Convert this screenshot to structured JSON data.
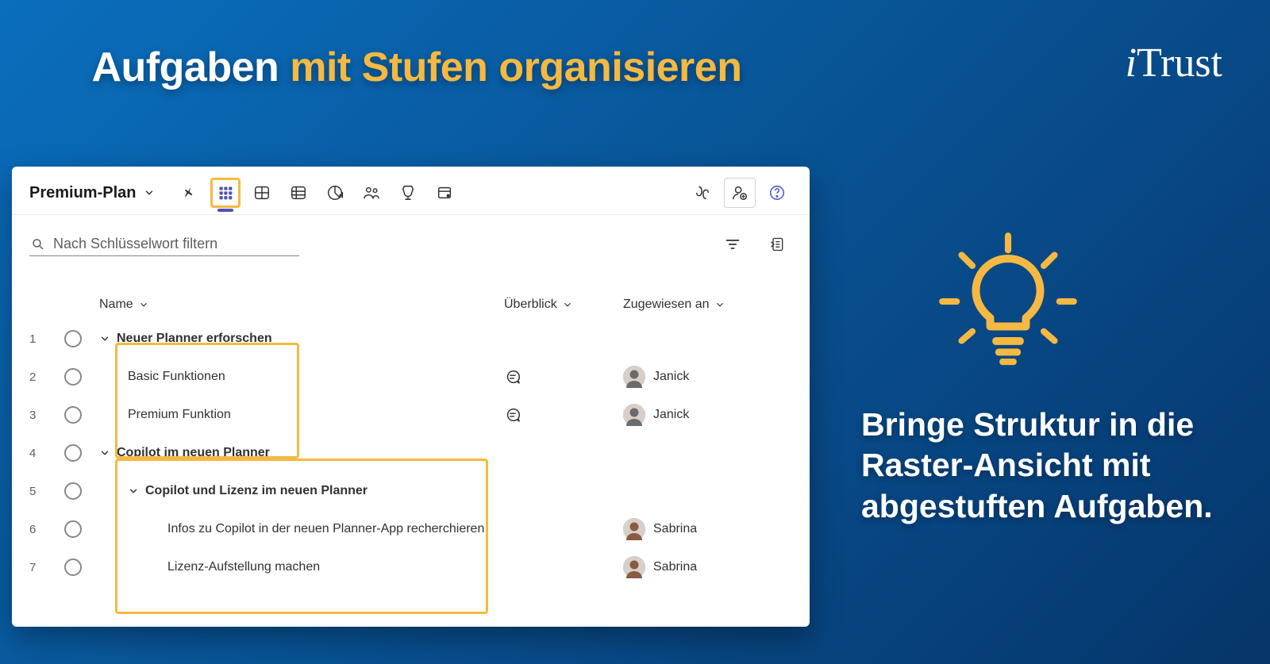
{
  "page": {
    "title_white": "Aufgaben",
    "title_accent": "mit Stufen organisieren",
    "logo": "iTrust",
    "tip": "Bringe Struktur in die Raster-Ansicht mit abgestuften Aufgaben."
  },
  "planner": {
    "plan_name": "Premium-Plan",
    "search_placeholder": "Nach Schlüsselwort filtern",
    "columns": {
      "name": "Name",
      "overview": "Überblick",
      "assigned": "Zugewiesen an"
    },
    "rows": [
      {
        "num": "1",
        "name": "Neuer Planner erforschen",
        "level": 0,
        "chevron": true,
        "bold": true,
        "chat": false,
        "assignee": ""
      },
      {
        "num": "2",
        "name": "Basic Funktionen",
        "level": 1,
        "chevron": false,
        "bold": false,
        "chat": true,
        "assignee": "Janick"
      },
      {
        "num": "3",
        "name": "Premium Funktion",
        "level": 1,
        "chevron": false,
        "bold": false,
        "chat": true,
        "assignee": "Janick"
      },
      {
        "num": "4",
        "name": "Copilot im neuen Planner",
        "level": 0,
        "chevron": true,
        "bold": true,
        "chat": false,
        "assignee": ""
      },
      {
        "num": "5",
        "name": "Copilot und Lizenz im neuen Planner",
        "level": 1,
        "chevron": true,
        "bold": true,
        "chat": false,
        "assignee": ""
      },
      {
        "num": "6",
        "name": "Infos zu Copilot in der neuen Planner-App recherchieren",
        "level": 2,
        "chevron": false,
        "bold": false,
        "chat": false,
        "assignee": "Sabrina"
      },
      {
        "num": "7",
        "name": "Lizenz-Aufstellung machen",
        "level": 2,
        "chevron": false,
        "bold": false,
        "chat": false,
        "assignee": "Sabrina"
      }
    ]
  }
}
